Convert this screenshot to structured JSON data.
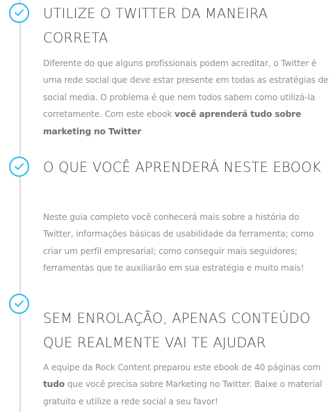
{
  "sections": [
    {
      "title": "UTILIZE O TWITTER DA MANEIRA CORRETA",
      "body_before": "Diferente do que alguns profissionais podem acreditar, o Twitter é uma rede social que deve estar presente em todas as estratégias de social media. O problema é que nem todos sabem como utilizá-la corretamente. Com este ebook ",
      "body_bold": "você aprenderá tudo sobre marketing no Twitter",
      "body_after": ""
    },
    {
      "title": "O QUE VOCÊ APRENDERÁ NESTE EBOOK",
      "body_before": "Neste guia completo você conhecerá mais sobre a história do Twitter, informações básicas de usabilidade da ferramenta; como criar um perfil empresarial; como conseguir mais seguidores; ferramentas que te auxiliarão em sua estratégia e muito mais!",
      "body_bold": "",
      "body_after": ""
    },
    {
      "title": "SEM ENROLAÇÃO, APENAS CONTEÚDO QUE REALMENTE VAI TE AJUDAR",
      "body_before": "A equipe da Rock Content preparou este ebook de 40 páginas com ",
      "body_bold": "tudo",
      "body_after": "  que você precisa sobre Marketing no Twitter. Baixe o material gratuito e utilize a rede social a seu favor!"
    }
  ],
  "icons": {
    "check": "check-icon"
  },
  "colors": {
    "accent": "#2bbcf2",
    "heading": "#3f3f3f",
    "body": "#8f8f8f",
    "timeline": "#dcdcdc"
  }
}
